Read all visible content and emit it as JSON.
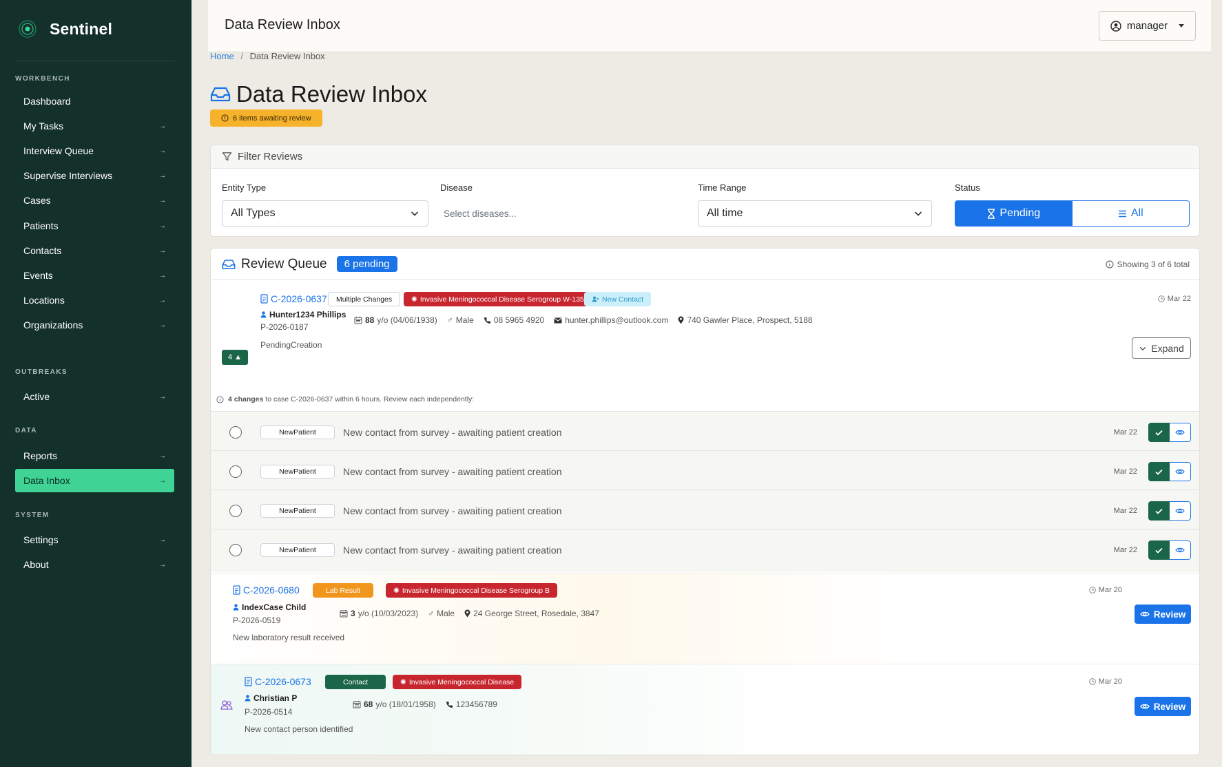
{
  "app": {
    "name": "Sentinel"
  },
  "sidebar": {
    "sections": [
      {
        "title": "WORKBENCH"
      },
      {
        "title": "OUTBREAKS"
      },
      {
        "title": "DATA"
      },
      {
        "title": "SYSTEM"
      }
    ],
    "items": [
      {
        "label": "Dashboard"
      },
      {
        "label": "My Tasks"
      },
      {
        "label": "Interview Queue"
      },
      {
        "label": "Supervise Interviews"
      },
      {
        "label": "Cases"
      },
      {
        "label": "Patients"
      },
      {
        "label": "Contacts"
      },
      {
        "label": "Events"
      },
      {
        "label": "Locations"
      },
      {
        "label": "Organizations"
      },
      {
        "label": "Active"
      },
      {
        "label": "Reports"
      },
      {
        "label": "Data Inbox"
      },
      {
        "label": "Settings"
      },
      {
        "label": "About"
      }
    ],
    "active_item": "Data Inbox"
  },
  "header": {
    "title": "Data Review Inbox",
    "user": "manager"
  },
  "breadcrumb": {
    "home": "Home",
    "separator": "/",
    "current": "Data Review Inbox"
  },
  "page": {
    "title": "Data Review Inbox",
    "badge": "6 items awaiting review"
  },
  "filters": {
    "title": "Filter Reviews",
    "entity_type": {
      "label": "Entity Type",
      "value": "All Types"
    },
    "disease": {
      "label": "Disease",
      "placeholder": "Select diseases..."
    },
    "time_range": {
      "label": "Time Range",
      "value": "All time"
    },
    "status": {
      "label": "Status",
      "options": [
        "Pending",
        "All"
      ],
      "selected": "Pending"
    }
  },
  "queue": {
    "title": "Review Queue",
    "pill": "6 pending",
    "showing": "Showing 3 of 6 total",
    "items": [
      {
        "case_id": "C-2026-0637",
        "tags": [
          "Multiple Changes",
          "Invasive Meningococcal Disease Serogroup W-135",
          "New Contact"
        ],
        "date": "Mar 22",
        "count_badge": "4",
        "patient_name": "Hunter1234 Phillips",
        "patient_id": "P-2026-0187",
        "age": "88",
        "age_rest": "y/o (04/06/1938)",
        "sex": "Male",
        "phone": "08 5965 4920",
        "email": "hunter.phillips@outlook.com",
        "address": "740 Gawler Place, Prospect, 5188",
        "status_text": "PendingCreation",
        "expand_label": "Expand",
        "changes_bold": "4 changes",
        "changes_rest": "to case C-2026-0637 within 6 hours. Review each independently:",
        "sub_items": [
          {
            "tag": "NewPatient",
            "text": "New contact from survey - awaiting patient creation",
            "date": "Mar 22"
          },
          {
            "tag": "NewPatient",
            "text": "New contact from survey - awaiting patient creation",
            "date": "Mar 22"
          },
          {
            "tag": "NewPatient",
            "text": "New contact from survey - awaiting patient creation",
            "date": "Mar 22"
          },
          {
            "tag": "NewPatient",
            "text": "New contact from survey - awaiting patient creation",
            "date": "Mar 22"
          }
        ]
      },
      {
        "case_id": "C-2026-0680",
        "tags": [
          "Lab Result",
          "Invasive Meningococcal Disease Serogroup B"
        ],
        "date": "Mar 20",
        "patient_name": "IndexCase Child",
        "patient_id": "P-2026-0519",
        "age": "3",
        "age_rest": "y/o (10/03/2023)",
        "sex": "Male",
        "address": "24 George Street, Rosedale, 3847",
        "description": "New laboratory result received",
        "review_label": "Review"
      },
      {
        "case_id": "C-2026-0673",
        "tags": [
          "Contact",
          "Invasive Meningococcal Disease"
        ],
        "date": "Mar 20",
        "patient_name": "Christian P",
        "patient_id": "P-2026-0514",
        "age": "68",
        "age_rest": "y/o (18/01/1958)",
        "phone": "123456789",
        "description": "New contact person identified",
        "review_label": "Review"
      }
    ]
  },
  "colors": {
    "sidebar_bg": "#14302a",
    "active_item": "#3fd396",
    "primary": "#1a73e8",
    "warning": "#f7b22c",
    "danger": "#c8262f",
    "success": "#1b6648"
  }
}
